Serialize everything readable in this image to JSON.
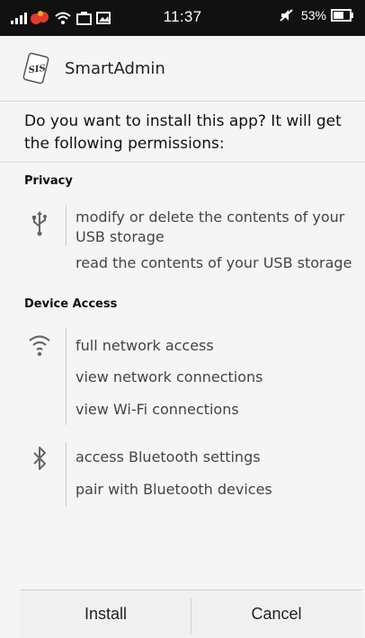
{
  "status_bar": {
    "time": "11:37",
    "battery": "53%",
    "icons": [
      "signal-icon",
      "notification-icon",
      "wifi-icon",
      "photo-icon",
      "gallery-icon",
      "mute-icon",
      "battery-icon"
    ]
  },
  "app": {
    "name": "SmartAdmin",
    "icon_text": "SIS"
  },
  "prompt": "Do you want to install this app? It will get the following permissions:",
  "sections": [
    {
      "title": "Privacy",
      "groups": [
        {
          "icon": "usb-icon",
          "items": [
            "modify or delete the contents of your USB storage",
            "read the contents of your USB storage"
          ]
        }
      ]
    },
    {
      "title": "Device Access",
      "groups": [
        {
          "icon": "wifi-icon",
          "items": [
            "full network access",
            "view network connections",
            "view Wi-Fi connections"
          ]
        },
        {
          "icon": "bluetooth-icon",
          "items": [
            "access Bluetooth settings",
            "pair with Bluetooth devices"
          ]
        }
      ]
    }
  ],
  "buttons": {
    "install": "Install",
    "cancel": "Cancel"
  },
  "colors": {
    "status_bar_bg": "#111111",
    "background": "#f5f5f5",
    "notification_red": "#e23b2e"
  }
}
